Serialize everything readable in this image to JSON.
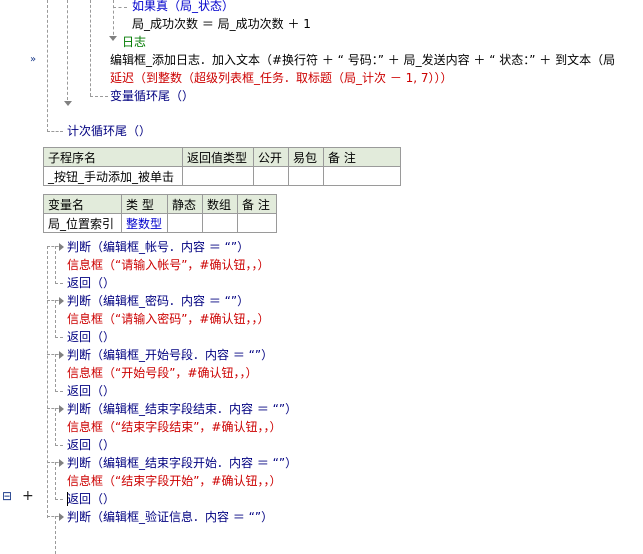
{
  "code_top": {
    "line_if_true": "如果真（局_状态）",
    "line_assign": "局_成功次数 ＝ 局_成功次数 ＋ 1",
    "line_log": "日志",
    "line_addtext": "编辑框_添加日志．加入文本（#换行符 ＋ “ 号码：” ＋ 局_发送内容 ＋ “ 状态：” ＋ 到文本（局",
    "line_delay": "延迟（到整数（超级列表框_任务．取标题（局_计次 － 1, 7）））",
    "line_varloop_end": "变量循环尾（）",
    "line_count_end": "计次循环尾（）"
  },
  "sub_table": {
    "headers": [
      "子程序名",
      "返回值类型",
      "公开",
      "易包",
      "备 注"
    ],
    "row": [
      "_按钮_手动添加_被单击",
      "",
      "",
      "",
      ""
    ]
  },
  "var_table": {
    "headers": [
      "变量名",
      "类 型",
      "静态",
      "数组",
      "备 注"
    ],
    "row": [
      "局_位置索引",
      "整数型",
      "",
      "",
      ""
    ]
  },
  "code_body": [
    {
      "text": "判断（编辑框_帐号．内容 ＝ “”）",
      "kind": "judge"
    },
    {
      "text": "信息框（“请输入帐号”，#确认钮，，）",
      "kind": "msg"
    },
    {
      "text": "返回（）",
      "kind": "ret"
    },
    {
      "text": "判断（编辑框_密码．内容 ＝ “”）",
      "kind": "judge"
    },
    {
      "text": "信息框（“请输入密码”，#确认钮，，）",
      "kind": "msg"
    },
    {
      "text": "返回（）",
      "kind": "ret"
    },
    {
      "text": "判断（编辑框_开始号段．内容 ＝ “”）",
      "kind": "judge"
    },
    {
      "text": "信息框（“开始号段”，#确认钮，，）",
      "kind": "msg"
    },
    {
      "text": "返回（）",
      "kind": "ret"
    },
    {
      "text": "判断（编辑框_结束字段结束．内容 ＝ “”）",
      "kind": "judge"
    },
    {
      "text": "信息框（“结束字段结束”，#确认钮，，）",
      "kind": "msg"
    },
    {
      "text": "返回（）",
      "kind": "ret"
    },
    {
      "text": "判断（编辑框_结束字段开始．内容 ＝ “”）",
      "kind": "judge"
    },
    {
      "text": "信息框（“结束字段开始”，#确认钮，，）",
      "kind": "msg"
    },
    {
      "text": "返回（）",
      "kind": "ret"
    },
    {
      "text": "判断（编辑框_验证信息．内容 ＝ “”）",
      "kind": "judge"
    }
  ],
  "gutter": {
    "fold_marker": "»",
    "tree_icon": "⊟",
    "add_icon": "+"
  }
}
